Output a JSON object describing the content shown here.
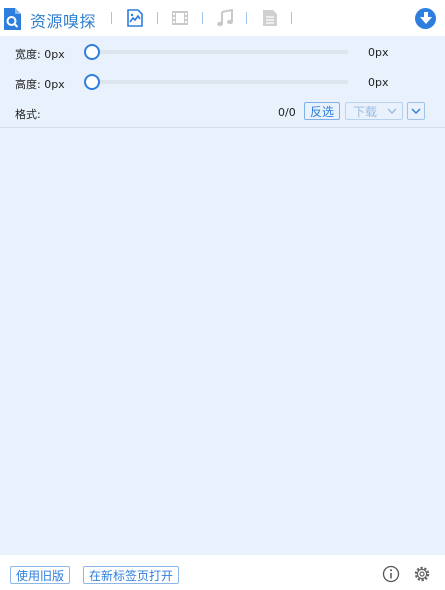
{
  "header": {
    "title": "资源嗅探",
    "icons": [
      "logo-search-icon",
      "image-icon",
      "video-icon",
      "music-icon",
      "document-icon",
      "download-icon"
    ]
  },
  "filters": {
    "width_label": "宽度: 0px",
    "width_value": "0px",
    "height_label": "高度: 0px",
    "height_value": "0px",
    "format_label": "格式:",
    "count": "0/0",
    "invert_label": "反选",
    "download_label": "下载"
  },
  "footer": {
    "old_version_label": "使用旧版",
    "open_new_tab_label": "在新标签页打开",
    "icons": [
      "info-icon",
      "settings-icon"
    ]
  },
  "colors": {
    "accent": "#2e7fdd",
    "panel_bg": "#e8f1fc"
  }
}
